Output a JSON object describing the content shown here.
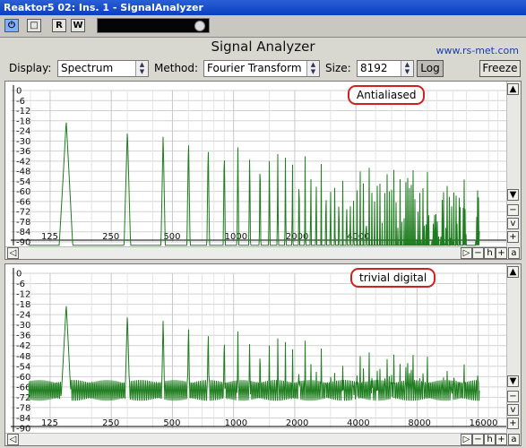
{
  "window": {
    "title": "Reaktor5 02: Ins. 1 - SignalAnalyzer"
  },
  "toolbar": {
    "buttons": [
      "⏻",
      "□",
      "R",
      "W"
    ]
  },
  "app": {
    "title": "Signal Analyzer",
    "url": "www.rs-met.com"
  },
  "controls": {
    "display_label": "Display:",
    "display_value": "Spectrum",
    "method_label": "Method:",
    "method_value": "Fourier Transform",
    "size_label": "Size:",
    "size_value": "8192",
    "log_label": "Log",
    "freeze_label": "Freeze"
  },
  "y_ticks": [
    "0",
    "-6",
    "-12",
    "-18",
    "-24",
    "-30",
    "-36",
    "-42",
    "-48",
    "-54",
    "-60",
    "-66",
    "-72",
    "-78",
    "-84",
    "-90"
  ],
  "plots": [
    {
      "label": "Antialiased",
      "x_ticks": [
        "125",
        "250",
        "500",
        "1000",
        "2000",
        "4000"
      ]
    },
    {
      "label": "trivial digital",
      "x_ticks": [
        "125",
        "250",
        "500",
        "1000",
        "2000",
        "4000",
        "8000",
        "16000"
      ]
    }
  ],
  "scrollbar": {
    "minus": "−",
    "plus": "+",
    "v": "v",
    "h": "h",
    "a": "a",
    "up": "▲",
    "down": "▼",
    "left": "◁",
    "right": "▷"
  },
  "colors": {
    "trace": "#1e7d1e",
    "titlebar": "#0a3fbf",
    "note_border": "#d02020"
  }
}
